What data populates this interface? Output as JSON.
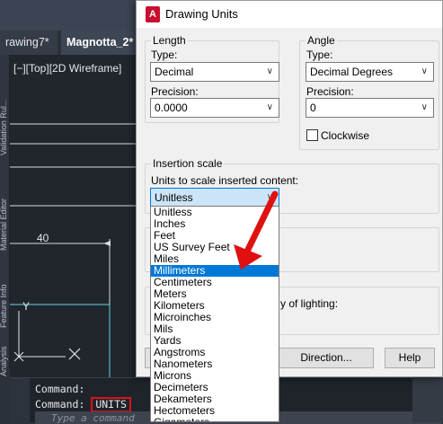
{
  "cad": {
    "tabs": [
      {
        "label": "rawing7*"
      },
      {
        "label": "Magnotta_2*"
      }
    ],
    "viewport_label": "[−][Top][2D Wireframe]",
    "side_tabs": [
      "Analysis",
      "Feature Info",
      "Material Editor",
      "Validation Rul..."
    ],
    "dimension": "40",
    "ucs_y": "Y",
    "command_lines": [
      "Command:",
      "Command:"
    ],
    "command_units": "UNITS",
    "command_placeholder": "Type a command"
  },
  "dialog": {
    "title": "Drawing Units",
    "icon": "autocad-a-icon",
    "length": {
      "legend": "Length",
      "type_label": "Type:",
      "type_value": "Decimal",
      "precision_label": "Precision:",
      "precision_value": "0.0000"
    },
    "angle": {
      "legend": "Angle",
      "type_label": "Type:",
      "type_value": "Decimal Degrees",
      "precision_label": "Precision:",
      "precision_value": "0",
      "clockwise_label": "Clockwise"
    },
    "insertion": {
      "legend": "Insertion scale",
      "units_label": "Units to scale inserted content:",
      "selected": "Unitless"
    },
    "lighting_text": "y of lighting:",
    "buttons": {
      "direction": "Direction...",
      "help": "Help"
    },
    "dropdown_items": [
      "Unitless",
      "Inches",
      "Feet",
      "US Survey Feet",
      "Miles",
      "Millimeters",
      "Centimeters",
      "Meters",
      "Kilometers",
      "Microinches",
      "Mils",
      "Yards",
      "Angstroms",
      "Nanometers",
      "Microns",
      "Decimeters",
      "Dekameters",
      "Hectometers",
      "Gigameters"
    ],
    "dropdown_highlighted": "Millimeters"
  },
  "colors": {
    "selection": "#0078d7",
    "annotation_red": "#e01010"
  }
}
